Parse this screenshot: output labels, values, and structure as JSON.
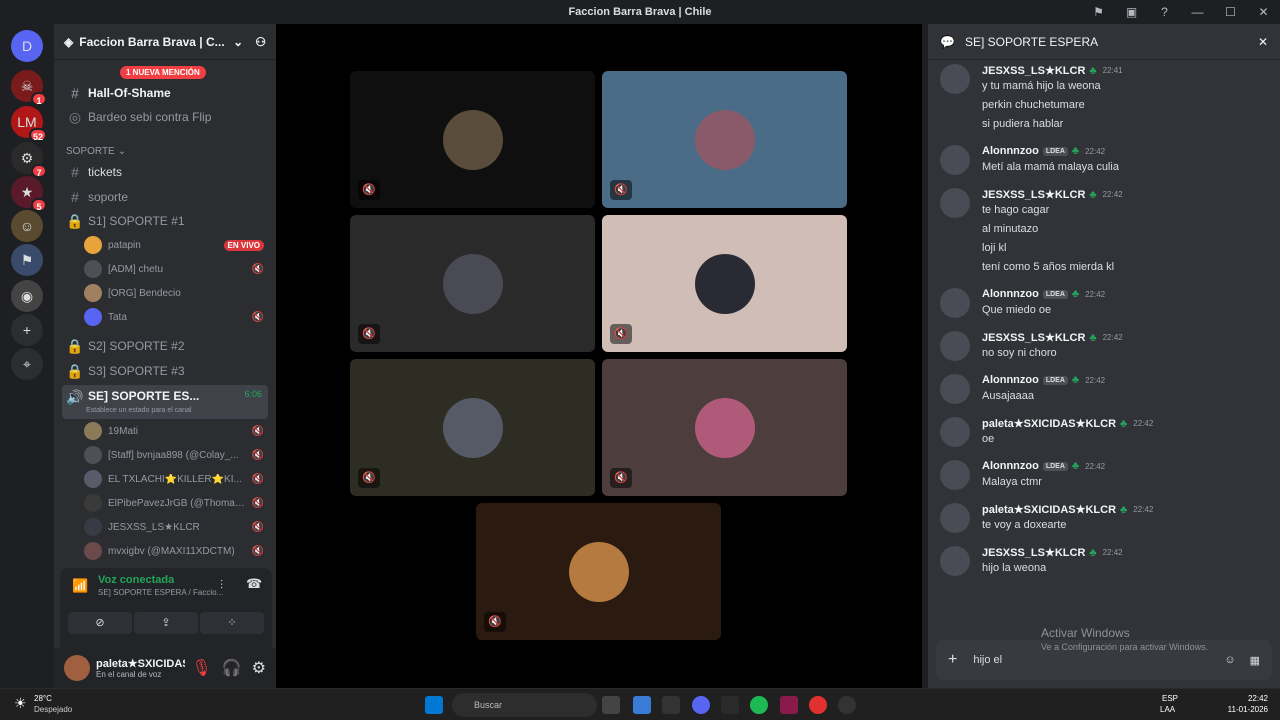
{
  "window": {
    "title": "Faccion Barra Brava | Chile",
    "controls": [
      "—",
      "☐",
      "✕"
    ]
  },
  "guilds": [
    {
      "label": "D",
      "badge": ""
    },
    {
      "label": "☠",
      "badge": "1"
    },
    {
      "label": "LM",
      "badge": "52"
    },
    {
      "label": "⚙",
      "badge": "7"
    },
    {
      "label": "★",
      "badge": "5"
    },
    {
      "label": "☺",
      "badge": ""
    },
    {
      "label": "⚑",
      "badge": ""
    },
    {
      "label": "◉",
      "badge": ""
    },
    {
      "label": "+",
      "badge": ""
    },
    {
      "label": "⌖",
      "badge": ""
    }
  ],
  "server": {
    "name": "Faccion Barra Brava | C...",
    "new_mention": "1 NUEVA MENCIÓN"
  },
  "channels": {
    "hall_of_shame": "Hall-Of-Shame",
    "bardeo": "Bardeo sebi contra Flip",
    "category": "SOPORTE",
    "tickets": "tickets",
    "soporte": "soporte",
    "s1": "S1] SOPORTE #1",
    "s2": "S2] SOPORTE #2",
    "s3": "S3] SOPORTE #3",
    "se": "SE] SOPORTE ES...",
    "se_time": "6:06",
    "se_status": "Establece un estado para el canal",
    "live": "EN VIVO"
  },
  "s1_users": [
    "patapin",
    "[ADM] chetu",
    "[ORG] Bendecio",
    "Tata"
  ],
  "se_users": [
    "19Mati",
    "[Staff] bvnjaa898 (@Colay_...",
    "EL TXLACHI⭐KILLER⭐KI...",
    "ElPibePavezJrGB (@Thomas...",
    "JESXSS_LS★KLCR",
    "mvxigbv (@MAXI11XDCTM)"
  ],
  "voice": {
    "connected": "Voz conectada",
    "channel": "SE] SOPORTE ESPERA / Faccio..."
  },
  "user": {
    "name": "paleta★SXICIDAS★KL...",
    "status": "En el canal de voz"
  },
  "tiles": [
    {
      "bg": "#0f0f0f",
      "pic": "#5a4c3a"
    },
    {
      "bg": "#4a6c86",
      "pic": "#8a5a6a"
    },
    {
      "bg": "#2a2a2b",
      "pic": "#4a4a55"
    },
    {
      "bg": "#cfbdb6",
      "pic": "#2a2a35"
    },
    {
      "bg": "#2e2d23",
      "pic": "#555a66"
    },
    {
      "bg": "#4e3d3d",
      "pic": "#b05a7a"
    },
    {
      "bg": "#2a1a10",
      "pic": "#b57a40"
    }
  ],
  "chat": {
    "title": "SE] SOPORTE ESPERA",
    "messages": [
      {
        "author": "JESXSS_LS★KLCR",
        "tag": "",
        "time": "22:41",
        "lines": [
          "y tu mamá hijo la weona",
          "perkin chuchetumare",
          "si pudiera hablar"
        ]
      },
      {
        "author": "Alonnnzoo",
        "tag": "LDEA",
        "time": "22:42",
        "lines": [
          "Metí ala mamá malaya culia"
        ]
      },
      {
        "author": "JESXSS_LS★KLCR",
        "tag": "",
        "time": "22:42",
        "lines": [
          "te hago cagar",
          "al minutazo",
          "loji kl",
          "tení como 5 años mierda kl"
        ]
      },
      {
        "author": "Alonnnzoo",
        "tag": "LDEA",
        "time": "22:42",
        "lines": [
          "Que miedo oe"
        ]
      },
      {
        "author": "JESXSS_LS★KLCR",
        "tag": "",
        "time": "22:42",
        "lines": [
          "no soy ni choro"
        ]
      },
      {
        "author": "Alonnnzoo",
        "tag": "LDEA",
        "time": "22:42",
        "lines": [
          "Ausajaaaa"
        ]
      },
      {
        "author": "paleta★SXICIDAS★KLCR",
        "tag": "",
        "time": "22:42",
        "lines": [
          "oe"
        ]
      },
      {
        "author": "Alonnnzoo",
        "tag": "LDEA",
        "time": "22:42",
        "lines": [
          "Malaya ctmr"
        ]
      },
      {
        "author": "paleta★SXICIDAS★KLCR",
        "tag": "",
        "time": "22:42",
        "lines": [
          "te voy a doxearte"
        ]
      },
      {
        "author": "JESXSS_LS★KLCR",
        "tag": "",
        "time": "22:42",
        "lines": [
          "hijo la weona"
        ]
      }
    ],
    "composer_value": "hijo el"
  },
  "watermark": {
    "line1": "Activar Windows",
    "line2": "Ve a Configuración para activar Windows."
  },
  "taskbar": {
    "weather_temp": "28°C",
    "weather_desc": "Despejado",
    "search": "Buscar",
    "lang": "ESP",
    "lang2": "LAA",
    "time": "22:42",
    "date": "11-01-2026"
  }
}
